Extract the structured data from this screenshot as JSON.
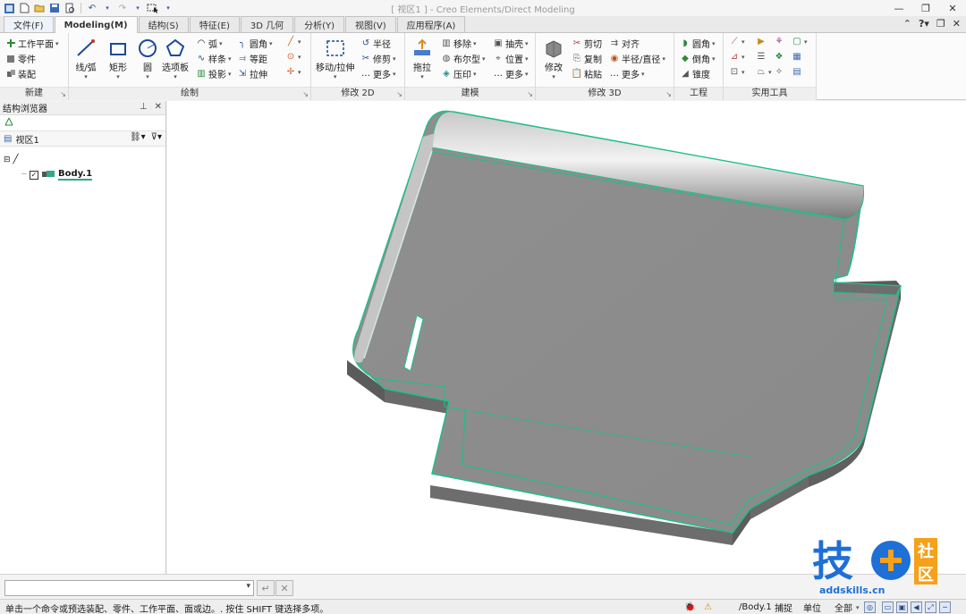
{
  "app": {
    "window_title": "[ 视区1 ] - Creo Elements/Direct Modeling"
  },
  "tabs": [
    {
      "label": "文件(F)"
    },
    {
      "label": "Modeling(M)"
    },
    {
      "label": "结构(S)"
    },
    {
      "label": "特征(E)"
    },
    {
      "label": "3D 几何"
    },
    {
      "label": "分析(Y)"
    },
    {
      "label": "视图(V)"
    },
    {
      "label": "应用程序(A)"
    }
  ],
  "ribbon": {
    "new": {
      "label": "新建",
      "items": [
        "工作平面",
        "零件",
        "装配"
      ]
    },
    "draw": {
      "label": "绘制",
      "big": [
        "线/弧",
        "矩形",
        "圆",
        "选项板"
      ],
      "small": [
        "弧",
        "样条",
        "投影",
        "圆角",
        "等距",
        "拉伸"
      ]
    },
    "modify2d": {
      "label": "修改 2D",
      "big": "移动/拉伸",
      "small": [
        "半径",
        "修剪",
        "更多"
      ]
    },
    "model": {
      "label": "建模",
      "big": "拖拉",
      "small": [
        "移除",
        "布尔型",
        "压印",
        "抽壳",
        "位置",
        "更多"
      ]
    },
    "modify3d": {
      "label": "修改 3D",
      "big": "修改",
      "small": [
        "剪切",
        "复制",
        "粘贴",
        "对齐",
        "半径/直径",
        "更多"
      ]
    },
    "engineering": {
      "label": "工程",
      "small": [
        "圆角",
        "倒角",
        "锥度"
      ]
    },
    "tools": {
      "label": "实用工具"
    }
  },
  "browser": {
    "title": "结构浏览器",
    "viewport_node": "视区1",
    "body_node": "Body.1"
  },
  "command": {
    "value": ""
  },
  "status": {
    "message": "单击一个命令或预选装配、零件、工作平面、面或边。. 按住 SHIFT 键选择多项。",
    "current_part": "/Body.1",
    "snap": "捕捉",
    "units": "单位",
    "filter": "全部"
  },
  "watermark": {
    "brand": "技",
    "community_1": "社",
    "community_2": "区",
    "url": "addskills.cn"
  },
  "colors": {
    "edge_highlight": "#19c08a",
    "watermark_blue": "#1e6fd6",
    "watermark_orange": "#f4a21b"
  }
}
